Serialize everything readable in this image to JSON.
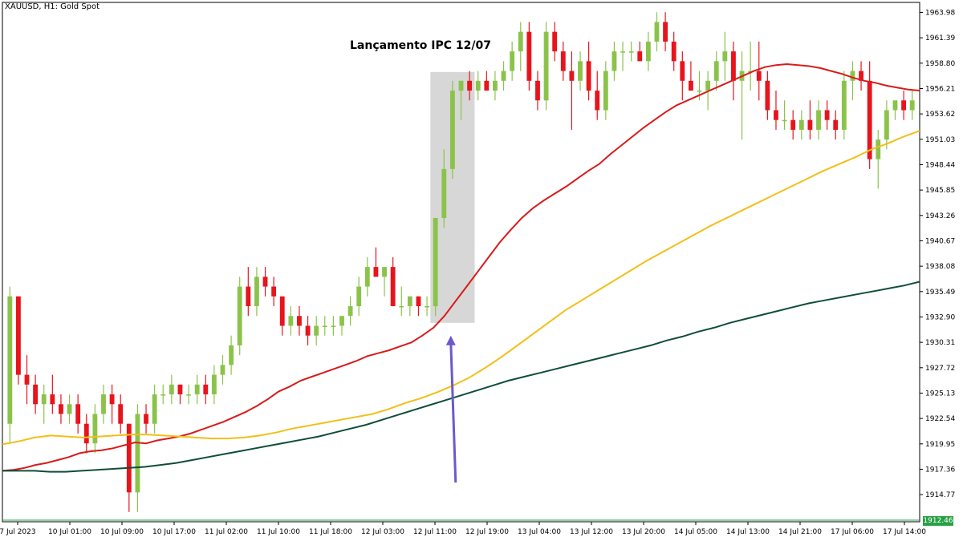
{
  "window": {
    "symbol_title": "XAUUSD, H1:  Gold Spot"
  },
  "annotation": {
    "label": "Lançamento IPC 12/07"
  },
  "current_price_label": "1912.46",
  "colors": {
    "bull": "#8bc34a",
    "bear": "#e8141c",
    "ema_fast": "#d91a1a",
    "ema_mid": "#f2bf17",
    "ema_slow": "#0f4d3a",
    "arrow": "#6a5acd",
    "highlight": "#d3d3d3",
    "price_line": "#27a145"
  },
  "chart_data": {
    "type": "candlestick",
    "title": "XAUUSD, H1:  Gold Spot",
    "ylim": [
      1912.0,
      1965.0
    ],
    "y_ticks": [
      "1963.98",
      "1961.39",
      "1958.80",
      "1956.21",
      "1953.62",
      "1951.03",
      "1948.44",
      "1945.85",
      "1943.26",
      "1940.67",
      "1938.08",
      "1935.49",
      "1932.90",
      "1930.31",
      "1927.72",
      "1925.13",
      "1922.54",
      "1919.95",
      "1917.36",
      "1914.77"
    ],
    "x_ticks": [
      "7 Jul 2023",
      "10 Jul 01:00",
      "10 Jul 09:00",
      "10 Jul 17:00",
      "11 Jul 02:00",
      "11 Jul 10:00",
      "11 Jul 18:00",
      "12 Jul 03:00",
      "12 Jul 11:00",
      "12 Jul 19:00",
      "13 Jul 04:00",
      "13 Jul 12:00",
      "13 Jul 20:00",
      "14 Jul 05:00",
      "14 Jul 13:00",
      "14 Jul 21:00",
      "17 Jul 06:00",
      "17 Jul 14:00"
    ],
    "candles": [
      [
        1922,
        1936,
        1920,
        1935
      ],
      [
        1935,
        1935,
        1926,
        1927
      ],
      [
        1927,
        1929,
        1924,
        1926
      ],
      [
        1926,
        1927,
        1923,
        1924
      ],
      [
        1924,
        1926,
        1922,
        1925
      ],
      [
        1925,
        1927,
        1923,
        1924
      ],
      [
        1924,
        1925,
        1922,
        1923
      ],
      [
        1923,
        1925,
        1922,
        1924
      ],
      [
        1924,
        1925,
        1921,
        1922
      ],
      [
        1922,
        1923,
        1919,
        1920
      ],
      [
        1920,
        1924,
        1919,
        1923
      ],
      [
        1923,
        1926,
        1922,
        1925
      ],
      [
        1925,
        1926,
        1922,
        1924
      ],
      [
        1924,
        1925,
        1921,
        1922
      ],
      [
        1922,
        1922,
        1913,
        1915
      ],
      [
        1915,
        1924,
        1913,
        1923
      ],
      [
        1923,
        1924,
        1921,
        1922
      ],
      [
        1922,
        1926,
        1921,
        1925
      ],
      [
        1925,
        1926,
        1924,
        1925
      ],
      [
        1925,
        1927,
        1924,
        1926
      ],
      [
        1926,
        1926,
        1924,
        1925
      ],
      [
        1925,
        1926,
        1924,
        1925
      ],
      [
        1925,
        1927,
        1924,
        1926
      ],
      [
        1926,
        1927,
        1924,
        1925
      ],
      [
        1925,
        1928,
        1924,
        1927
      ],
      [
        1927,
        1929,
        1926,
        1928
      ],
      [
        1928,
        1931,
        1927,
        1930
      ],
      [
        1930,
        1937,
        1929,
        1936
      ],
      [
        1936,
        1938,
        1933,
        1934
      ],
      [
        1934,
        1938,
        1933,
        1937
      ],
      [
        1937,
        1938,
        1935,
        1936
      ],
      [
        1936,
        1937,
        1934,
        1935
      ],
      [
        1935,
        1935,
        1931,
        1932
      ],
      [
        1932,
        1934,
        1931,
        1933
      ],
      [
        1933,
        1934,
        1931,
        1932
      ],
      [
        1932,
        1933,
        1930,
        1931
      ],
      [
        1931,
        1933,
        1930,
        1932
      ],
      [
        1932,
        1933,
        1931,
        1932
      ],
      [
        1932,
        1933,
        1931,
        1932
      ],
      [
        1932,
        1933,
        1931,
        1933
      ],
      [
        1933,
        1935,
        1932,
        1934
      ],
      [
        1934,
        1937,
        1933,
        1936
      ],
      [
        1936,
        1939,
        1935,
        1938
      ],
      [
        1938,
        1940,
        1937,
        1937
      ],
      [
        1937,
        1938,
        1935,
        1938
      ],
      [
        1938,
        1939,
        1935,
        1934
      ],
      [
        1934,
        1936,
        1933,
        1934
      ],
      [
        1934,
        1935,
        1933,
        1935
      ],
      [
        1935,
        1935,
        1933,
        1934
      ],
      [
        1934,
        1935,
        1933,
        1934
      ],
      [
        1934,
        1937,
        1933,
        1943
      ],
      [
        1943,
        1950,
        1942,
        1948
      ],
      [
        1948,
        1957,
        1947,
        1956
      ],
      [
        1956,
        1957,
        1953,
        1957
      ],
      [
        1957,
        1958,
        1955,
        1956
      ],
      [
        1956,
        1958,
        1955,
        1957
      ],
      [
        1957,
        1958,
        1956,
        1956
      ],
      [
        1956,
        1958,
        1955,
        1957
      ],
      [
        1957,
        1959,
        1956,
        1958
      ],
      [
        1958,
        1961,
        1957,
        1960
      ],
      [
        1960,
        1963,
        1958,
        1962
      ],
      [
        1962,
        1963,
        1956,
        1957
      ],
      [
        1957,
        1958,
        1954,
        1955
      ],
      [
        1955,
        1963,
        1954,
        1962
      ],
      [
        1962,
        1963,
        1959,
        1960
      ],
      [
        1960,
        1961,
        1957,
        1958
      ],
      [
        1958,
        1960,
        1952,
        1957
      ],
      [
        1957,
        1960,
        1956,
        1959
      ],
      [
        1959,
        1961,
        1955,
        1956
      ],
      [
        1956,
        1958,
        1953,
        1954
      ],
      [
        1954,
        1959,
        1953,
        1958
      ],
      [
        1958,
        1961,
        1957,
        1960
      ],
      [
        1960,
        1961,
        1958,
        1960
      ],
      [
        1960,
        1961,
        1959,
        1960
      ],
      [
        1960,
        1961,
        1959,
        1959
      ],
      [
        1959,
        1962,
        1958,
        1961
      ],
      [
        1961,
        1964,
        1960,
        1963
      ],
      [
        1963,
        1964,
        1960,
        1961
      ],
      [
        1961,
        1962,
        1958,
        1959
      ],
      [
        1959,
        1960,
        1955,
        1957
      ],
      [
        1957,
        1959,
        1956,
        1956
      ],
      [
        1956,
        1958,
        1955,
        1956
      ],
      [
        1956,
        1958,
        1954,
        1957
      ],
      [
        1957,
        1960,
        1956,
        1959
      ],
      [
        1959,
        1962,
        1957,
        1960
      ],
      [
        1960,
        1961,
        1955,
        1957
      ],
      [
        1957,
        1960,
        1951,
        1958
      ],
      [
        1958,
        1961,
        1956,
        1958
      ],
      [
        1958,
        1961,
        1955,
        1957
      ],
      [
        1957,
        1958,
        1953,
        1954
      ],
      [
        1954,
        1956,
        1952,
        1953
      ],
      [
        1953,
        1955,
        1952,
        1953
      ],
      [
        1953,
        1954,
        1951,
        1952
      ],
      [
        1952,
        1954,
        1951,
        1953
      ],
      [
        1953,
        1955,
        1951,
        1952
      ],
      [
        1952,
        1955,
        1951,
        1954
      ],
      [
        1954,
        1955,
        1952,
        1953
      ],
      [
        1953,
        1954,
        1951,
        1952
      ],
      [
        1952,
        1958,
        1951,
        1957
      ],
      [
        1957,
        1959,
        1955,
        1958
      ],
      [
        1958,
        1959,
        1956,
        1957
      ],
      [
        1957,
        1959,
        1948,
        1949
      ],
      [
        1949,
        1952,
        1946,
        1951
      ],
      [
        1951,
        1955,
        1950,
        1954
      ],
      [
        1954,
        1955,
        1953,
        1955
      ],
      [
        1955,
        1956,
        1953,
        1954
      ],
      [
        1954,
        1956,
        1953,
        1955
      ]
    ],
    "series": [
      {
        "name": "",
        "color_key": "ema_fast",
        "values": [
          1917.2,
          1917.3,
          1917.5,
          1917.8,
          1918.0,
          1918.3,
          1918.6,
          1919.0,
          1919.2,
          1919.3,
          1919.5,
          1919.8,
          1920.1,
          1920.0,
          1920.3,
          1920.5,
          1920.7,
          1921.0,
          1921.4,
          1921.8,
          1922.2,
          1922.7,
          1923.2,
          1923.8,
          1924.5,
          1925.3,
          1925.8,
          1926.4,
          1926.8,
          1927.2,
          1927.6,
          1928.0,
          1928.4,
          1928.9,
          1929.2,
          1929.5,
          1929.9,
          1930.3,
          1931.0,
          1931.8,
          1933.0,
          1934.5,
          1936.0,
          1937.5,
          1939.0,
          1940.5,
          1941.8,
          1943.0,
          1944.0,
          1944.8,
          1945.5,
          1946.2,
          1947.0,
          1947.8,
          1948.5,
          1949.5,
          1950.4,
          1951.3,
          1952.2,
          1953.0,
          1953.8,
          1954.5,
          1955.0,
          1955.5,
          1956.0,
          1956.5,
          1957.0,
          1957.5,
          1958.0,
          1958.4,
          1958.6,
          1958.7,
          1958.6,
          1958.5,
          1958.3,
          1958.0,
          1957.7,
          1957.3,
          1957.0,
          1956.8,
          1956.5,
          1956.3,
          1956.1,
          1956.0
        ]
      },
      {
        "name": "",
        "color_key": "ema_mid",
        "values": [
          1919.9,
          1920.2,
          1920.6,
          1920.8,
          1920.7,
          1920.6,
          1920.7,
          1920.8,
          1920.9,
          1920.9,
          1920.8,
          1920.7,
          1920.6,
          1920.5,
          1920.5,
          1920.6,
          1920.8,
          1921.1,
          1921.5,
          1921.8,
          1922.1,
          1922.4,
          1922.7,
          1923.0,
          1923.5,
          1924.1,
          1924.6,
          1925.2,
          1925.9,
          1926.7,
          1927.7,
          1928.8,
          1930.0,
          1931.2,
          1932.4,
          1933.6,
          1934.6,
          1935.6,
          1936.6,
          1937.6,
          1938.6,
          1939.5,
          1940.4,
          1941.3,
          1942.2,
          1943.0,
          1943.8,
          1944.6,
          1945.4,
          1946.2,
          1947.0,
          1947.8,
          1948.5,
          1949.2,
          1950.0,
          1950.6,
          1951.3,
          1951.9
        ]
      },
      {
        "name": "",
        "color_key": "ema_slow",
        "values": [
          1917.2,
          1917.2,
          1917.2,
          1917.1,
          1917.1,
          1917.2,
          1917.3,
          1917.4,
          1917.5,
          1917.6,
          1917.8,
          1918.0,
          1918.3,
          1918.6,
          1918.9,
          1919.2,
          1919.5,
          1919.8,
          1920.1,
          1920.4,
          1920.7,
          1921.1,
          1921.5,
          1921.9,
          1922.4,
          1922.9,
          1923.4,
          1923.9,
          1924.4,
          1924.9,
          1925.4,
          1925.9,
          1926.4,
          1926.8,
          1927.2,
          1927.6,
          1928.0,
          1928.4,
          1928.8,
          1929.2,
          1929.6,
          1930.0,
          1930.5,
          1930.9,
          1931.4,
          1931.8,
          1932.3,
          1932.7,
          1933.1,
          1933.5,
          1933.9,
          1934.3,
          1934.6,
          1934.9,
          1935.2,
          1935.5,
          1935.8,
          1936.1,
          1936.5
        ]
      }
    ],
    "highlight_range_candles": [
      50,
      54
    ],
    "highlight_price_range": [
      1932.3,
      1957.9
    ],
    "arrow_price_range": [
      1916.0,
      1931.0
    ]
  }
}
